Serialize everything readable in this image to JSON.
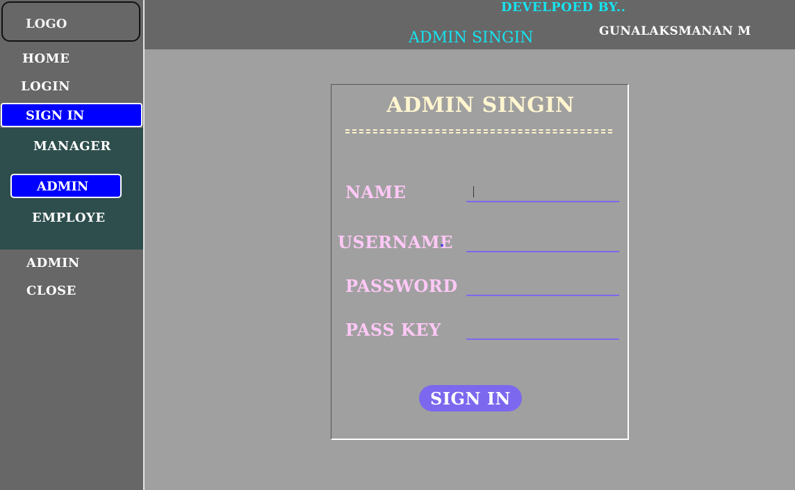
{
  "sidebar": {
    "logo": "LOGO",
    "items": {
      "home": "HOME",
      "login": "LOGIN",
      "sign_in": "SIGN IN",
      "admin": "ADMIN",
      "close": "CLOSE"
    },
    "submenu": {
      "manager": "MANAGER",
      "admin": "ADMIN",
      "employe": "EMPLOYE"
    }
  },
  "header": {
    "developed_by": "DEVELPOED BY..",
    "title": "ADMIN SINGIN",
    "developer_name": "GUNALAKSMANAN M"
  },
  "form": {
    "title": "ADMIN SINGIN",
    "fields": {
      "name": {
        "label": "NAME",
        "value": ""
      },
      "username": {
        "label": "USERNAME",
        "value": ""
      },
      "password": {
        "label": "PASSWORD",
        "value": ""
      },
      "pass_key": {
        "label": "PASS KEY",
        "value": ""
      }
    },
    "submit_label": "SIGN IN"
  },
  "colors": {
    "accent_cyan": "#17e3ef",
    "active_blue": "#0000ff",
    "button_purple": "#7b68ee",
    "label_pink": "#ffc8f6",
    "title_cream": "#fff5cf",
    "submenu_bg": "#2e4e4d"
  }
}
